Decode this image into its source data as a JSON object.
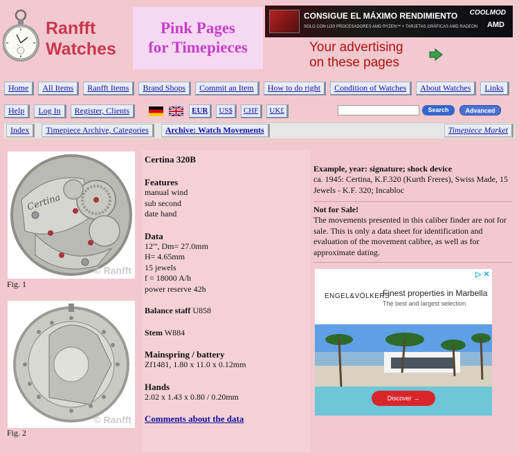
{
  "logo": {
    "line1": "Ranfft",
    "line2": "Watches"
  },
  "pink_pages": {
    "line1": "Pink Pages",
    "line2": "for Timepieces"
  },
  "banner": {
    "headline": "CONSIGUE EL MÁXIMO RENDIMIENTO",
    "sub": "SOLO CON LOS PROCESADORES AMD RYZEN™ + TARJETAS GRÁFICAS AMD RADEON",
    "brand1": "COOLMOD",
    "brand2": "AMD"
  },
  "advertising": {
    "line1": "Your advertising",
    "line2": "on these pages"
  },
  "nav_main": [
    "Home",
    "All Items",
    "Ranfft Items",
    "Brand Shops",
    "Commit an Item",
    "How to do right",
    "Condition of Watches",
    "About Watches",
    "Links"
  ],
  "nav_user": [
    "Help",
    "Log In",
    "Register, Clients"
  ],
  "currencies": [
    "EUR",
    "US$",
    "CHF",
    "UK£"
  ],
  "search": {
    "button": "Search",
    "advanced": "Advanced"
  },
  "nav_section": {
    "index": "Index",
    "archive": "Timepiece Archive, Categories",
    "movements": "Archive: Watch Movements",
    "market": "Timepiece Market"
  },
  "figures": {
    "fig1": "Fig. 1",
    "fig2": "Fig. 2",
    "copyright": "© Ranfft",
    "engraving": "Certina"
  },
  "caliber": {
    "title": "Certina 320B",
    "features_h": "Features",
    "features": [
      "manual wind",
      "sub second",
      "date hand"
    ],
    "data_h": "Data",
    "data": [
      "12''', Dm= 27.0mm",
      "H= 4.65mm",
      "15 jewels",
      "f = 18000 A/h",
      "power reserve 42h"
    ],
    "balance_h": "Balance staff",
    "balance_v": "U858",
    "stem_h": "Stem",
    "stem_v": "W884",
    "mainspring_h": "Mainspring / battery",
    "mainspring_v": "Zf1481, 1.80 x 11.0 x 0.12mm",
    "hands_h": "Hands",
    "hands_v": "2.02 x 1.43 x 0.80 / 0.20mm",
    "comments": "Comments about the data"
  },
  "example": {
    "h": "Example, year: signature; shock device",
    "text": "ca. 1945: Certina, K.F.320 (Kurth Freres), Swiss Made, 15 Jewels - K.F. 320; Incabloc"
  },
  "notforsale": {
    "h": "Not for Sale!",
    "text": "The movements presented in this caliber finder are not for sale. This is only a data sheet for identification and evaluation of the movement calibre, as well as for approximate dating."
  },
  "ad2": {
    "brand": "ENGEL&VÖLKERS",
    "title": "Finest properties in Marbella",
    "sub": "The best and largest selection",
    "button": "Discover →"
  },
  "colors": {
    "bg": "#f2c9cf",
    "logo_red": "#c8374f",
    "pink_title": "#c43fc8",
    "link": "#1010a0"
  }
}
